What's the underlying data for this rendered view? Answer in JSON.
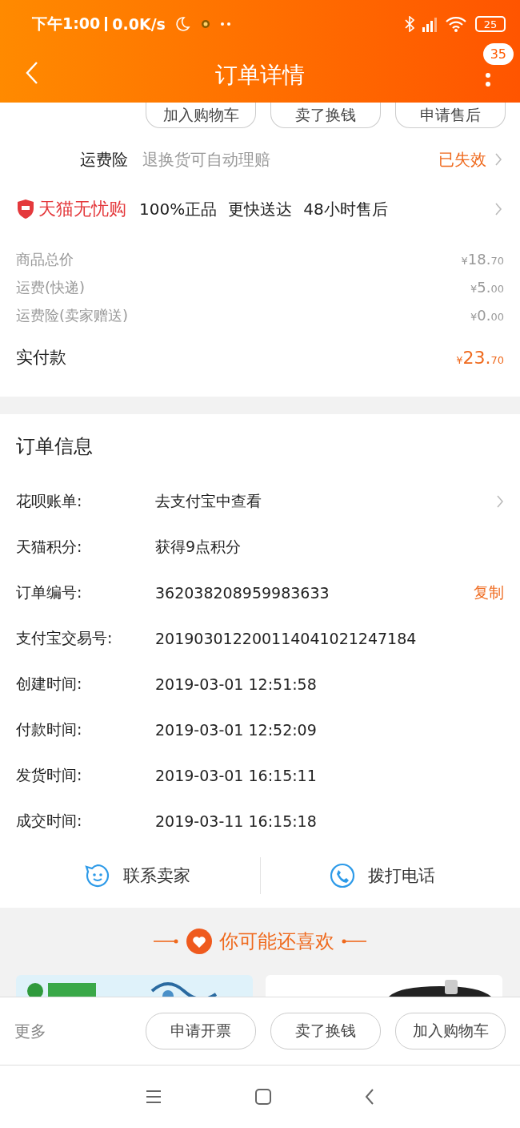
{
  "status_bar": {
    "time": "下午1:00",
    "speed": "0.0K/s",
    "battery": "25"
  },
  "header": {
    "title": "订单详情",
    "badge": "35"
  },
  "top_actions": [
    "加入购物车",
    "卖了换钱",
    "申请售后"
  ],
  "insurance": {
    "label": "运费险",
    "description": "退换货可自动理赔",
    "status": "已失效"
  },
  "guarantee": {
    "brand": "天猫无忧购",
    "features": [
      "100%正品",
      "更快送达",
      "48小时售后"
    ]
  },
  "prices": [
    {
      "label": "商品总价",
      "currency": "¥",
      "main": "18.",
      "cents": "70"
    },
    {
      "label": "运费(快递)",
      "currency": "¥",
      "main": "5.",
      "cents": "00"
    },
    {
      "label": "运费险(卖家赠送)",
      "currency": "¥",
      "main": "0.",
      "cents": "00"
    }
  ],
  "total": {
    "label": "实付款",
    "currency": "¥",
    "main": "23.",
    "cents": "70"
  },
  "order_info": {
    "title": "订单信息",
    "rows": [
      {
        "kind": "link",
        "label": "花呗账单:",
        "value": "去支付宝中查看"
      },
      {
        "kind": "plain",
        "label": "天猫积分:",
        "value": "获得9点积分"
      },
      {
        "kind": "copy",
        "label": "订单编号:",
        "value": "362038208959983633",
        "action": "复制"
      },
      {
        "kind": "plain",
        "label": "支付宝交易号:",
        "value": "201903012200114041021247184"
      },
      {
        "kind": "plain",
        "label": "创建时间:",
        "value": "2019-03-01 12:51:58"
      },
      {
        "kind": "plain",
        "label": "付款时间:",
        "value": "2019-03-01 12:52:09"
      },
      {
        "kind": "plain",
        "label": "发货时间:",
        "value": "2019-03-01 16:15:11"
      },
      {
        "kind": "plain",
        "label": "成交时间:",
        "value": "2019-03-11 16:15:18"
      }
    ]
  },
  "contact": [
    {
      "kind": "chat",
      "label": "联系卖家"
    },
    {
      "kind": "phone",
      "label": "拨打电话"
    }
  ],
  "recommend": {
    "title": "你可能还喜欢"
  },
  "bottom_bar": {
    "more": "更多",
    "buttons": [
      "申请开票",
      "卖了换钱",
      "加入购物车"
    ]
  }
}
